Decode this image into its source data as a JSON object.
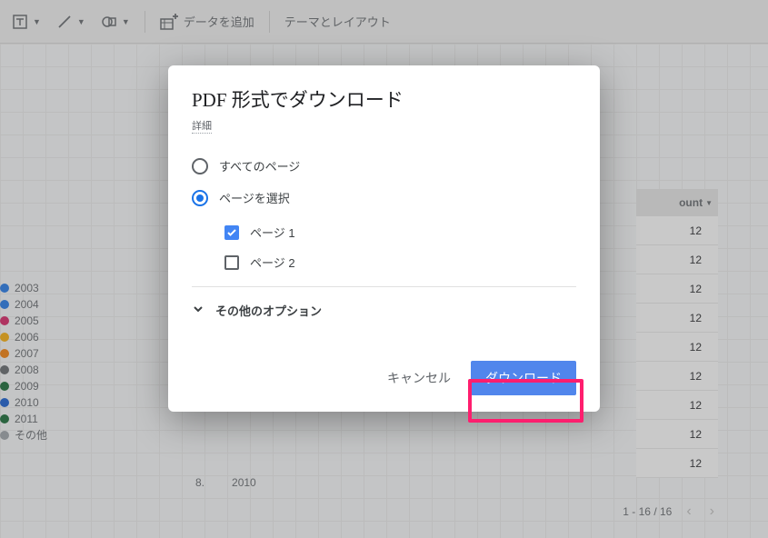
{
  "toolbar": {
    "add_data": "データを追加",
    "theme_layout": "テーマとレイアウト"
  },
  "legend": {
    "items": [
      {
        "label": "2003",
        "color": "#1a73e8"
      },
      {
        "label": "2004",
        "color": "#1a73e8"
      },
      {
        "label": "2005",
        "color": "#d81b60"
      },
      {
        "label": "2006",
        "color": "#f9ab00"
      },
      {
        "label": "2007",
        "color": "#f57c00"
      },
      {
        "label": "2008",
        "color": "#5f6368"
      },
      {
        "label": "2009",
        "color": "#0d652d"
      },
      {
        "label": "2010",
        "color": "#0b57d0"
      },
      {
        "label": "2011",
        "color": "#0d652d"
      },
      {
        "label": "その他",
        "color": "#9aa0a6"
      }
    ]
  },
  "table": {
    "header": "ount",
    "rows": [
      "12",
      "12",
      "12",
      "12",
      "12",
      "12",
      "12",
      "12",
      "12"
    ],
    "visible_row_index": "8.",
    "visible_row_label": "2010",
    "pager": "1 - 16 / 16"
  },
  "dialog": {
    "title": "PDF 形式でダウンロード",
    "details": "詳細",
    "option_all": "すべてのページ",
    "option_select": "ページを選択",
    "page1": "ページ 1",
    "page2": "ページ 2",
    "other_options": "その他のオプション",
    "cancel": "キャンセル",
    "download": "ダウンロード"
  }
}
